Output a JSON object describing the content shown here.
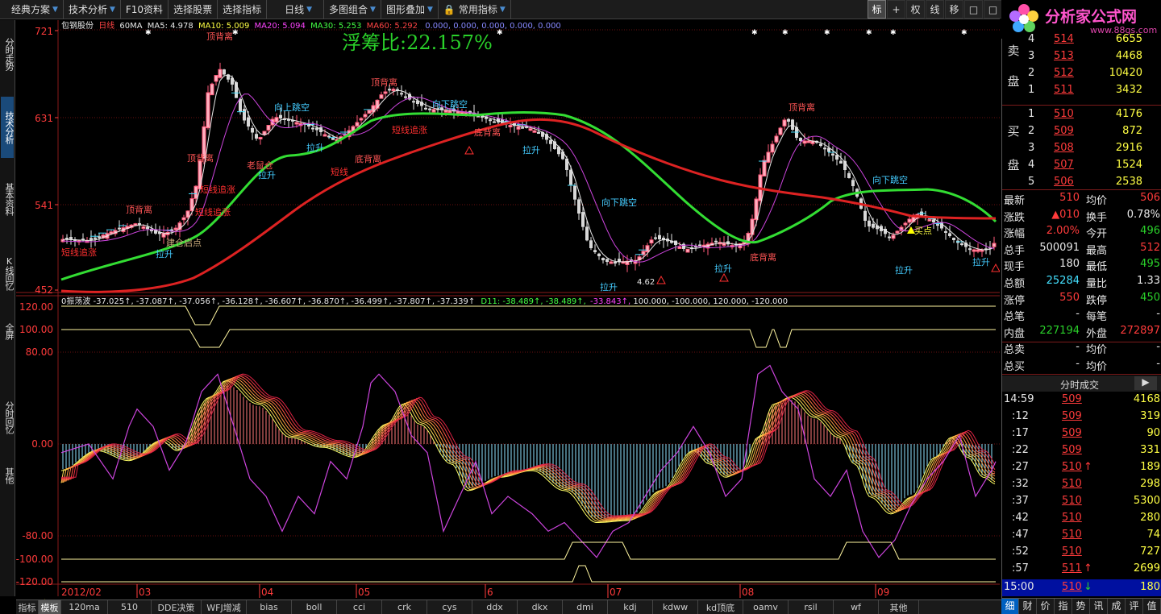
{
  "toolbar": {
    "items": [
      "经典方案",
      "技术分析",
      "F10资料",
      "选择股票",
      "选择指标",
      "日线",
      "多图组合",
      "图形叠加",
      "常用指标"
    ],
    "right_buttons": [
      "标",
      "+",
      "权",
      "线",
      "移",
      "□",
      "□"
    ]
  },
  "logo": {
    "text": "分析家公式网",
    "url": "www.88gs.com"
  },
  "left_tabs": [
    "分时走势",
    "技术分析",
    "基本资料",
    "K线回忆",
    "全屏",
    "分时回忆",
    "其他"
  ],
  "header": {
    "stock": "包钢股份",
    "period": "日线",
    "ma_label": "60MA",
    "ma5": "MA5: 4.978",
    "ma10": "MA10: 5.009",
    "ma20": "MA20: 5.094",
    "ma30": "MA30: 5.253",
    "ma60": "MA60: 5.292",
    "extra": "0.000,  0.000,  0.000,  0.000,  0.000"
  },
  "float_ratio": "浮筹比:22.157%",
  "price_axis": [
    "721",
    "631",
    "541",
    "452"
  ],
  "indicator": {
    "header": "0振荡波  -37.025↑,  -37.087↑,  -37.056↑,  -36.128↑,  -36.607↑,  -36.870↑,  -36.499↑,  -37.807↑,  -37.339↑",
    "d11": "D11:  -38.489↑,  -38.489↑,",
    "d_pink": "-33.843↑,",
    "d_rest": " 100.000,  -100.000,  120.000,  -120.000",
    "axis": [
      "120.00",
      "100.00",
      "80.00",
      "0.00",
      "-80.00",
      "-100.00",
      "-120.00"
    ]
  },
  "time_axis": [
    "2012/02",
    "03",
    "04",
    "05",
    "6",
    "07",
    "08",
    "09"
  ],
  "annotations": {
    "top_div": "顶背离",
    "bottom_div": "底背离",
    "chase": "短线追涨",
    "short": "短线",
    "pull_up": "拉升",
    "gap_down": "向下跳空",
    "gap_up": "向上跳空",
    "start": "建仓启点",
    "buy": "买点",
    "low": "4.62",
    "old": "老鼠仓"
  },
  "order_book": {
    "sell": [
      {
        "level": "4",
        "price": "514",
        "vol": "6655"
      },
      {
        "level": "3",
        "price": "513",
        "vol": "4468"
      },
      {
        "level": "2",
        "price": "512",
        "vol": "10420"
      },
      {
        "level": "1",
        "price": "511",
        "vol": "3432"
      }
    ],
    "buy": [
      {
        "level": "1",
        "price": "510",
        "vol": "4176"
      },
      {
        "level": "2",
        "price": "509",
        "vol": "872"
      },
      {
        "level": "3",
        "price": "508",
        "vol": "2916"
      },
      {
        "level": "4",
        "price": "507",
        "vol": "1524"
      },
      {
        "level": "5",
        "price": "506",
        "vol": "2538"
      }
    ],
    "sell_label": [
      "卖",
      "盘"
    ],
    "buy_label": [
      "买",
      "盘"
    ]
  },
  "quote": [
    {
      "l1": "最新",
      "v1": "510",
      "c1": "red",
      "l2": "均价",
      "v2": "506",
      "c2": "red"
    },
    {
      "l1": "涨跌",
      "v1": "▲010",
      "c1": "red",
      "l2": "换手",
      "v2": "0.78%",
      "c2": "white"
    },
    {
      "l1": "涨幅",
      "v1": "2.00%",
      "c1": "red",
      "l2": "今开",
      "v2": "496",
      "c2": "green"
    },
    {
      "l1": "总手",
      "v1": "500091",
      "c1": "white",
      "l2": "最高",
      "v2": "512",
      "c2": "red"
    },
    {
      "l1": "现手",
      "v1": "180",
      "c1": "white",
      "l2": "最低",
      "v2": "495",
      "c2": "green"
    },
    {
      "l1": "总额",
      "v1": "25284",
      "c1": "cyan",
      "l2": "量比",
      "v2": "1.33",
      "c2": "white"
    },
    {
      "l1": "涨停",
      "v1": "550",
      "c1": "red",
      "l2": "跌停",
      "v2": "450",
      "c2": "green"
    },
    {
      "l1": "总笔",
      "v1": "-",
      "c1": "white",
      "l2": "每笔",
      "v2": "-",
      "c2": "white"
    },
    {
      "l1": "内盘",
      "v1": "227194",
      "c1": "green",
      "l2": "外盘",
      "v2": "272897",
      "c2": "red"
    },
    {
      "l1": "总卖",
      "v1": "-",
      "c1": "white",
      "l2": "均价",
      "v2": "-",
      "c2": "white"
    },
    {
      "l1": "总买",
      "v1": "-",
      "c1": "white",
      "l2": "均价",
      "v2": "-",
      "c2": "white"
    }
  ],
  "ticks_header": "分时成交",
  "ticks": [
    {
      "t": "14:59",
      "p": "509",
      "a": "",
      "v": "4168"
    },
    {
      "t": ":12",
      "p": "509",
      "a": "",
      "v": "319"
    },
    {
      "t": ":17",
      "p": "509",
      "a": "",
      "v": "90"
    },
    {
      "t": ":22",
      "p": "509",
      "a": "",
      "v": "331"
    },
    {
      "t": ":27",
      "p": "510",
      "a": "↑",
      "v": "189"
    },
    {
      "t": ":32",
      "p": "510",
      "a": "",
      "v": "298"
    },
    {
      "t": ":37",
      "p": "510",
      "a": "",
      "v": "5300"
    },
    {
      "t": ":42",
      "p": "510",
      "a": "",
      "v": "280"
    },
    {
      "t": ":47",
      "p": "510",
      "a": "",
      "v": "74"
    },
    {
      "t": ":52",
      "p": "510",
      "a": "",
      "v": "727"
    },
    {
      "t": ":57",
      "p": "511",
      "a": "↑",
      "v": "2699"
    },
    {
      "t": "15:00",
      "p": "510",
      "a": "↓",
      "v": "180"
    }
  ],
  "bottom": {
    "period": "日线",
    "tabs": [
      "指标",
      "模板",
      "120ma",
      "510",
      "DDE决策",
      "WFJ增减",
      "bias",
      "boll",
      "cci",
      "crk",
      "cys",
      "ddx",
      "dkx",
      "dmi",
      "kdj",
      "kdww",
      "kd顶底",
      "oamv",
      "rsil",
      "wf",
      "其他"
    ],
    "right_tabs": [
      "细",
      "财",
      "价",
      "指",
      "势",
      "讯",
      "成",
      "评",
      "值"
    ]
  }
}
